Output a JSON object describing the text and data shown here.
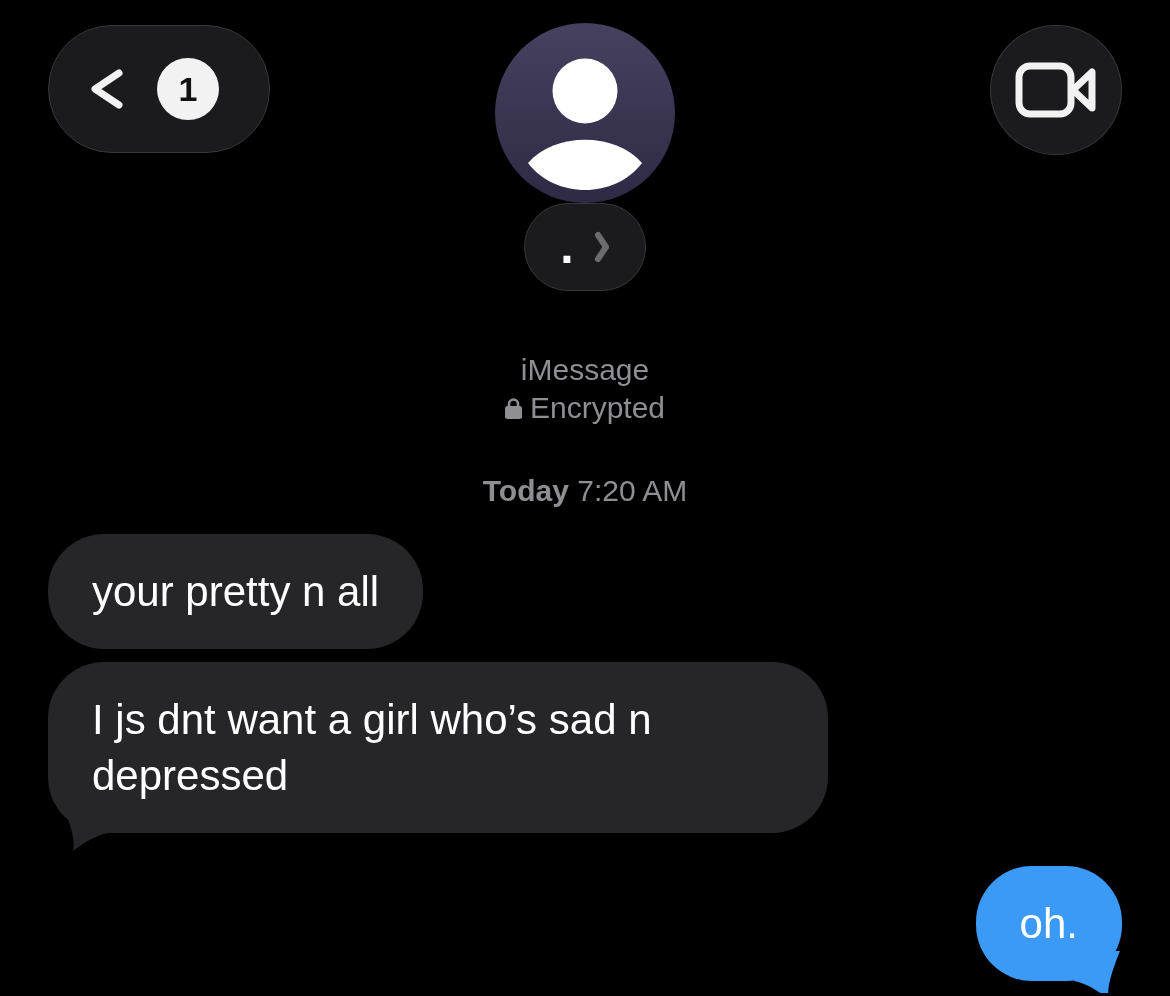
{
  "header": {
    "back_button": {
      "badge": "1"
    },
    "contact": {
      "name": "."
    }
  },
  "conversation_info": {
    "service": "iMessage",
    "encryption": "Encrypted"
  },
  "timestamp": "**Today** 7:20 AM",
  "messages": [
    {
      "kind": "received",
      "text": "your pretty n all"
    },
    {
      "kind": "received",
      "text": "I js dnt want a girl who’s sad n depressed"
    },
    {
      "kind": "sent",
      "text": "oh."
    }
  ]
}
